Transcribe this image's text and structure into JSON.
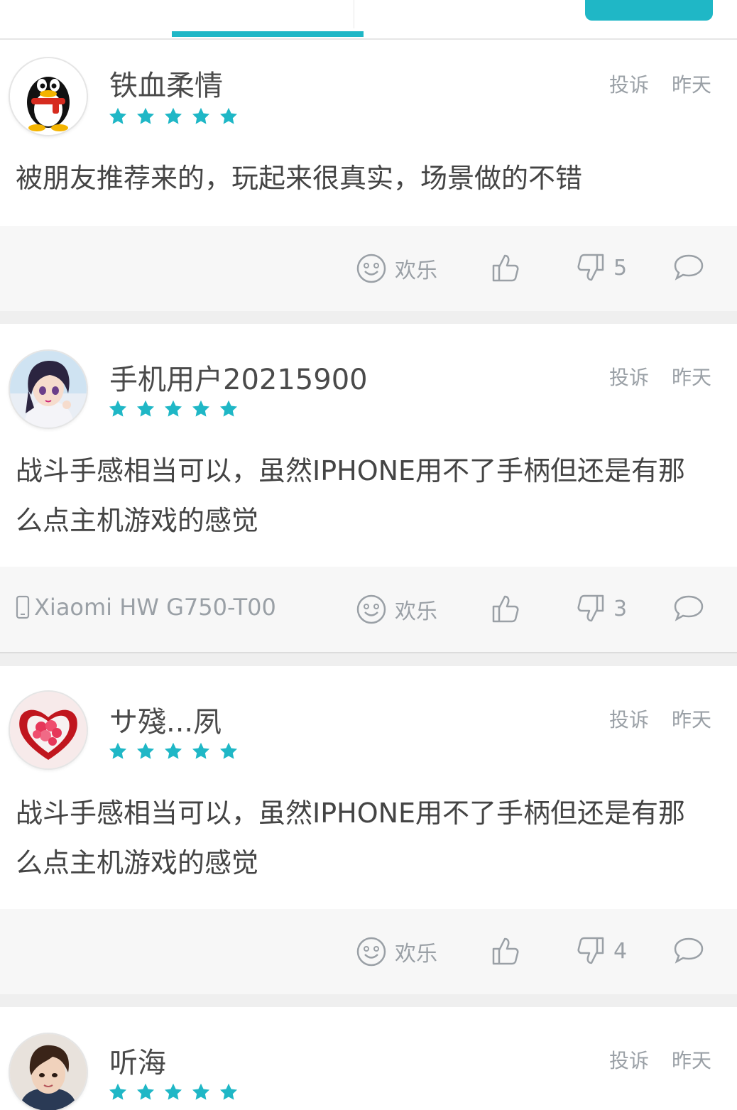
{
  "colors": {
    "accent": "#1fb7c6",
    "muted": "#9aa0a6",
    "text": "#444444"
  },
  "reviews": [
    {
      "username": "铁血柔情",
      "rating": 5,
      "complain_label": "投诉",
      "time": "昨天",
      "content": "被朋友推荐来的，玩起来很真实，场景做的不错",
      "device": "",
      "mood_label": "欢乐",
      "dislike_count": "5",
      "avatar_icon": "qq-penguin-avatar"
    },
    {
      "username": "手机用户20215900",
      "rating": 5,
      "complain_label": "投诉",
      "time": "昨天",
      "content": "战斗手感相当可以，虽然IPHONE用不了手柄但还是有那么点主机游戏的感觉",
      "device": "Xiaomi HW G750-T00",
      "mood_label": "欢乐",
      "dislike_count": "3",
      "avatar_icon": "anime-girl-avatar"
    },
    {
      "username": "サ殘...夙",
      "rating": 5,
      "complain_label": "投诉",
      "time": "昨天",
      "content": "战斗手感相当可以，虽然IPHONE用不了手柄但还是有那么点主机游戏的感觉",
      "device": "",
      "mood_label": "欢乐",
      "dislike_count": "4",
      "avatar_icon": "heart-strawberry-avatar"
    },
    {
      "username": "听海",
      "rating": 5,
      "complain_label": "投诉",
      "time": "昨天",
      "avatar_icon": "boy-portrait-avatar"
    }
  ]
}
